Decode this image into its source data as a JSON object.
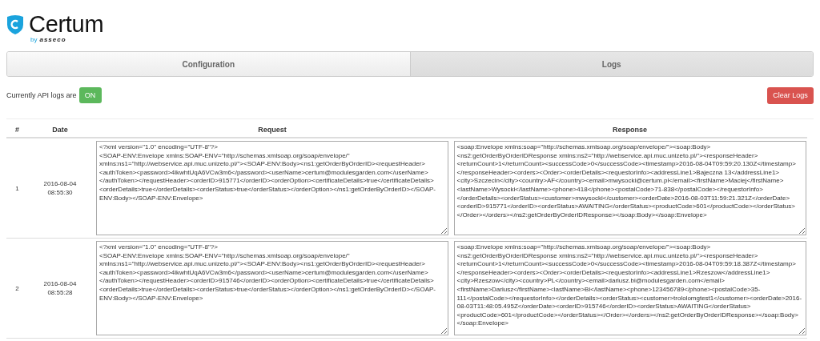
{
  "logo": {
    "name": "Certum",
    "byline": "by",
    "company": "asseco"
  },
  "tabs": [
    {
      "label": "Configuration",
      "selected": false
    },
    {
      "label": "Logs",
      "selected": true
    }
  ],
  "status": {
    "label": "Currently API logs are",
    "state": "ON",
    "on": true
  },
  "clear_button": "Clear Logs",
  "table": {
    "columns": [
      "#",
      "Date",
      "Request",
      "Response"
    ],
    "rows": [
      {
        "index": "1",
        "date": "2016-08-04",
        "time": "08:55:30",
        "request": "<?xml version=\"1.0\" encoding=\"UTF-8\"?>\n<SOAP-ENV:Envelope xmlns:SOAP-ENV=\"http://schemas.xmlsoap.org/soap/envelope/\" xmlns:ns1=\"http://webservice.api.muc.unizeto.pl/\"><SOAP-ENV:Body><ns1:getOrderByOrderID><requestHeader><authToken><password>4lkwhtUqA6VCw3m6</password><userName>certum@modulesgarden.com</userName></authToken></requestHeader><orderID>915771</orderID><orderOption><certificateDetails>true</certificateDetails><orderDetails>true</orderDetails><orderStatus>true</orderStatus></orderOption></ns1:getOrderByOrderID></SOAP-ENV:Body></SOAP-ENV:Envelope>",
        "response": "<soap:Envelope xmlns:soap=\"http://schemas.xmlsoap.org/soap/envelope/\"><soap:Body><ns2:getOrderByOrderIDResponse xmlns:ns2=\"http://webservice.api.muc.unizeto.pl/\"><responseHeader><returnCount>1</returnCount><successCode>0</successCode><timestamp>2016-08-04T09:59:20.130Z</timestamp></responseHeader><orders><Order><orderDetails><requestorInfo><addressLine1>Bajeczna 13</addressLine1><city>Szczecin</city><country>AF</country><email>mwysocki@certum.pl</email><firstName>Maciej</firstName><lastName>Wysocki</lastName><phone>418</phone><postalCode>71-838</postalCode></requestorInfo></orderDetails><orderStatus><customer>mwysocki</customer><orderDate>2016-08-03T11:59:21.321Z</orderDate><orderID>915771</orderID><orderStatus>AWAITING</orderStatus><productCode>601</productCode></orderStatus></Order></orders></ns2:getOrderByOrderIDResponse></soap:Body></soap:Envelope>"
      },
      {
        "index": "2",
        "date": "2016-08-04",
        "time": "08:55:28",
        "request": "<?xml version=\"1.0\" encoding=\"UTF-8\"?>\n<SOAP-ENV:Envelope xmlns:SOAP-ENV=\"http://schemas.xmlsoap.org/soap/envelope/\" xmlns:ns1=\"http://webservice.api.muc.unizeto.pl/\"><SOAP-ENV:Body><ns1:getOrderByOrderID><requestHeader><authToken><password>4lkwhtUqA6VCw3m6</password><userName>certum@modulesgarden.com</userName></authToken></requestHeader><orderID>915746</orderID><orderOption><certificateDetails>true</certificateDetails><orderDetails>true</orderDetails><orderStatus>true</orderStatus></orderOption></ns1:getOrderByOrderID></SOAP-ENV:Body></SOAP-ENV:Envelope>",
        "response": "<soap:Envelope xmlns:soap=\"http://schemas.xmlsoap.org/soap/envelope/\"><soap:Body><ns2:getOrderByOrderIDResponse xmlns:ns2=\"http://webservice.api.muc.unizeto.pl/\"><responseHeader><returnCount>1</returnCount><successCode>0</successCode><timestamp>2016-08-04T09:59:18.387Z</timestamp></responseHeader><orders><Order><orderDetails><requestorInfo><addressLine1>Rzeszow</addressLine1><city>Rzeszow</city><country>PL</country><email>dariusz.bi@modulesgarden.com</email><firstName>Dariusz</firstName><lastName>Bi</lastName><phone>123456789</phone><postalCode>35-111</postalCode></requestorInfo></orderDetails><orderStatus><customer>trololomgtest1</customer><orderDate>2016-08-03T11:48:05.495Z</orderDate><orderID>915746</orderID><orderStatus>AWAITING</orderStatus><productCode>601</productCode></orderStatus></Order></orders></ns2:getOrderByOrderIDResponse></soap:Body></soap:Envelope>"
      }
    ]
  }
}
